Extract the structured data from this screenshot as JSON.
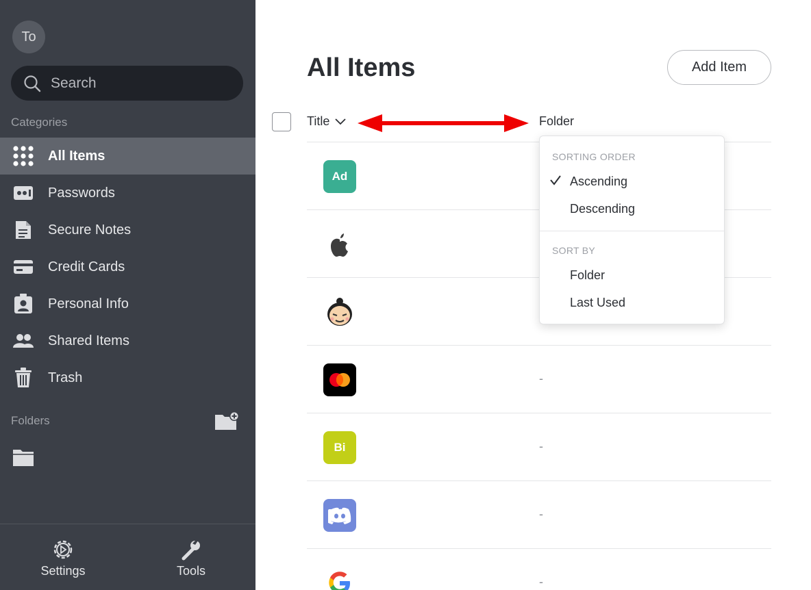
{
  "sidebar": {
    "avatar_initials": "To",
    "search_placeholder": "Search",
    "categories_label": "Categories",
    "items": [
      {
        "label": "All Items",
        "icon": "grid-icon",
        "active": true
      },
      {
        "label": "Passwords",
        "icon": "password-icon"
      },
      {
        "label": "Secure Notes",
        "icon": "note-icon"
      },
      {
        "label": "Credit Cards",
        "icon": "credit-card-icon"
      },
      {
        "label": "Personal Info",
        "icon": "id-card-icon"
      },
      {
        "label": "Shared Items",
        "icon": "people-icon"
      },
      {
        "label": "Trash",
        "icon": "trash-icon"
      }
    ],
    "folders_label": "Folders",
    "bottom": {
      "settings_label": "Settings",
      "tools_label": "Tools"
    }
  },
  "main": {
    "title": "All Items",
    "add_item_label": "Add Item",
    "columns": {
      "title": "Title",
      "folder": "Folder"
    },
    "rows": [
      {
        "logo_text": "Ad",
        "logo_color": "#3aae92",
        "folder": ""
      },
      {
        "logo_text": "",
        "logo": "apple-icon",
        "folder": ""
      },
      {
        "logo_text": "",
        "logo": "sumo-avatar-icon",
        "folder": ""
      },
      {
        "logo_text": "",
        "logo": "mastercard-icon",
        "folder": "-"
      },
      {
        "logo_text": "Bi",
        "logo_color": "#c2cf17",
        "folder": "-"
      },
      {
        "logo_text": "",
        "logo": "discord-icon",
        "folder": "-"
      },
      {
        "logo_text": "",
        "logo": "google-icon",
        "folder": "-"
      }
    ]
  },
  "dropdown": {
    "sorting_order_label": "SORTING ORDER",
    "ascending_label": "Ascending",
    "descending_label": "Descending",
    "selected_order": "Ascending",
    "sort_by_label": "SORT BY",
    "sort_by_options": [
      "Folder",
      "Last Used"
    ]
  },
  "colors": {
    "sidebar_bg": "#3b3f47",
    "sidebar_active": "#61656d",
    "annotation_arrow": "#ee0000"
  }
}
